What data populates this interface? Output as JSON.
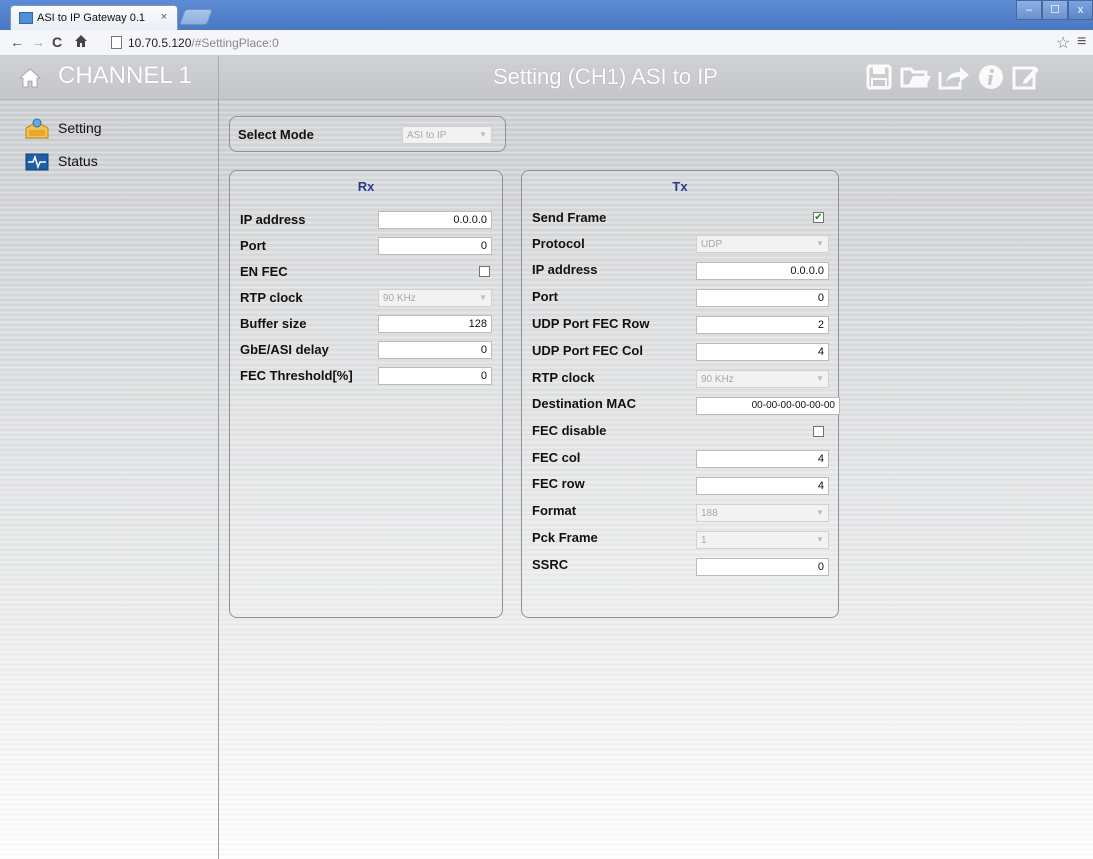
{
  "browser": {
    "tab_title": "ASI to IP Gateway 0.1",
    "tab_close": "×",
    "url_host": "10.70.5.120",
    "url_path": "/#SettingPlace:0",
    "controls": {
      "minimize": "–",
      "maximize": "☐",
      "close": "x"
    }
  },
  "header": {
    "channel": "CHANNEL 1",
    "title": "Setting (CH1) ASI to IP",
    "tools": [
      "save-icon",
      "folder-open-icon",
      "export-icon",
      "info-icon",
      "edit-icon"
    ]
  },
  "sidebar": {
    "items": [
      {
        "label": "Setting",
        "icon": "setting-icon"
      },
      {
        "label": "Status",
        "icon": "status-icon"
      }
    ]
  },
  "mode": {
    "label": "Select Mode",
    "value": "ASI to IP"
  },
  "rx": {
    "title": "Rx",
    "ip_address": {
      "label": "IP address",
      "value": "0.0.0.0"
    },
    "port": {
      "label": "Port",
      "value": "0"
    },
    "en_fec": {
      "label": "EN FEC",
      "checked": false
    },
    "rtp_clock": {
      "label": "RTP clock",
      "value": "90 KHz"
    },
    "buffer_size": {
      "label": "Buffer size",
      "value": "128"
    },
    "gbe_asi_delay": {
      "label": "GbE/ASI delay",
      "value": "0"
    },
    "fec_threshold": {
      "label": "FEC Threshold[%]",
      "value": "0"
    }
  },
  "tx": {
    "title": "Tx",
    "send_frame": {
      "label": "Send Frame",
      "checked": true
    },
    "protocol": {
      "label": "Protocol",
      "value": "UDP"
    },
    "ip_address": {
      "label": "IP address",
      "value": "0.0.0.0"
    },
    "port": {
      "label": "Port",
      "value": "0"
    },
    "udp_port_fec_row": {
      "label": "UDP Port FEC Row",
      "value": "2"
    },
    "udp_port_fec_col": {
      "label": "UDP Port FEC Col",
      "value": "4"
    },
    "rtp_clock": {
      "label": "RTP clock",
      "value": "90 KHz"
    },
    "destination_mac": {
      "label": "Destination MAC",
      "value": "00-00-00-00-00-00"
    },
    "fec_disable": {
      "label": "FEC disable",
      "checked": false
    },
    "fec_col": {
      "label": "FEC col",
      "value": "4"
    },
    "fec_row": {
      "label": "FEC row",
      "value": "4"
    },
    "format": {
      "label": "Format",
      "value": "188"
    },
    "pck_frame": {
      "label": "Pck Frame",
      "value": "1"
    },
    "ssrc": {
      "label": "SSRC",
      "value": "0"
    }
  }
}
